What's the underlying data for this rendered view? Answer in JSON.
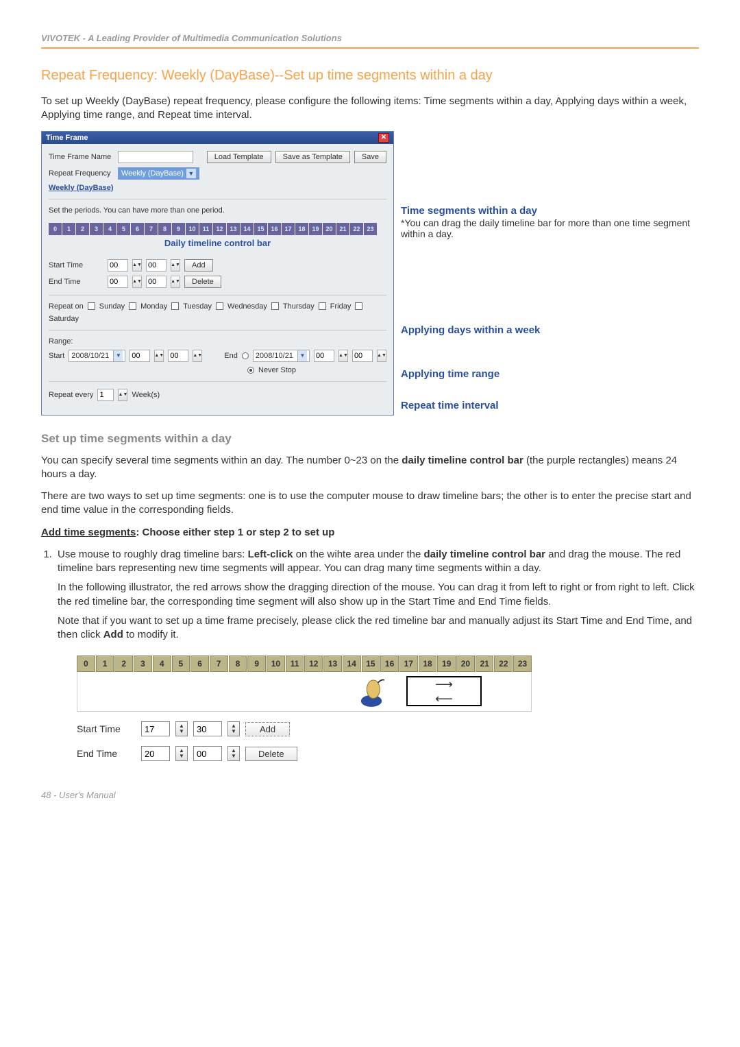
{
  "header": "VIVOTEK - A Leading Provider of Multimedia Communication Solutions",
  "title": "Repeat Frequency: Weekly (DayBase)--Set up time segments within a day",
  "intro": "To set up Weekly (DayBase) repeat frequency, please configure the following items: Time segments within a day, Applying days within a week, Applying time range, and Repeat time interval.",
  "dialog": {
    "titlebar": "Time Frame",
    "name_label": "Time Frame Name",
    "btn_load": "Load Template",
    "btn_saveas": "Save as Template",
    "btn_save": "Save",
    "repeat_label": "Repeat Frequency",
    "repeat_value": "Weekly (DayBase)",
    "section_link": "Weekly (DayBase)",
    "periods_instr": "Set the periods. You can have more than one period.",
    "hours": [
      "0",
      "1",
      "2",
      "3",
      "4",
      "5",
      "6",
      "7",
      "8",
      "9",
      "10",
      "11",
      "12",
      "13",
      "14",
      "15",
      "16",
      "17",
      "18",
      "19",
      "20",
      "21",
      "22",
      "23"
    ],
    "timeline_caption": "Daily timeline control bar",
    "start_label": "Start Time",
    "start_h": "00",
    "start_m": "00",
    "end_label": "End Time",
    "end_h": "00",
    "end_m": "00",
    "btn_add": "Add",
    "btn_delete": "Delete",
    "repeat_on_label": "Repeat on",
    "days": [
      "Sunday",
      "Monday",
      "Tuesday",
      "Wednesday",
      "Thursday",
      "Friday",
      "Saturday"
    ],
    "range_label": "Range:",
    "range_start_label": "Start",
    "range_start_date": "2008/10/21",
    "range_sh": "00",
    "range_sm": "00",
    "range_end_label": "End",
    "range_end_date": "2008/10/21",
    "range_eh": "00",
    "range_em": "00",
    "never_stop": "Never Stop",
    "repeat_every_label": "Repeat every",
    "repeat_every_val": "1",
    "repeat_every_unit": "Week(s)"
  },
  "annots": {
    "a1_title": "Time segments within a day",
    "a1_sub": "*You can drag the daily timeline bar for more than one time segment within a day.",
    "a2": "Applying days within a week",
    "a3": "Applying time range",
    "a4": "Repeat time interval"
  },
  "sec2_title": "Set up time segments within a day",
  "p1a": "You can specify several time segments within an day. The number 0~23 on the ",
  "p1b": "daily timeline control bar",
  "p1c": " (the purple rectangles) means 24 hours a day.",
  "p2": "There are two ways to set up time segments: one is to use the computer mouse to draw timeline bars; the other is to enter the precise start and end time value in the corresponding fields.",
  "addseg_label": "Add time segments",
  "addseg_rest": ": Choose either step 1 or step 2 to set up",
  "step1a": "Use mouse to roughly drag timeline bars: ",
  "step1b": "Left-click",
  "step1c": " on the wihte area under the ",
  "step1d": "daily timeline control bar",
  "step1e": " and drag the mouse. The red timeline bars representing new time segments will appear. You can drag many time segments within a day.",
  "step1p2": "In the following illustrator, the red arrows show the dragging direction of the mouse. You can drag it from left to right or from right to left. Click the red timeline bar, the corresponding time segment will also show up in the Start Time and End Time fields.",
  "step1p3a": "Note that if you want to set up a time frame precisely, please click the red timeline bar and manually adjust its Start Time and End Time, and then click ",
  "step1p3b": "Add",
  "step1p3c": " to modify it.",
  "bigtl": {
    "hours": [
      "0",
      "1",
      "2",
      "3",
      "4",
      "5",
      "6",
      "7",
      "8",
      "9",
      "10",
      "11",
      "12",
      "13",
      "14",
      "15",
      "16",
      "17",
      "18",
      "19",
      "20",
      "21",
      "22",
      "23"
    ],
    "start_label": "Start Time",
    "start_h": "17",
    "start_m": "30",
    "end_label": "End Time",
    "end_h": "20",
    "end_m": "00",
    "btn_add": "Add",
    "btn_delete": "Delete"
  },
  "footer": "48 - User's Manual"
}
